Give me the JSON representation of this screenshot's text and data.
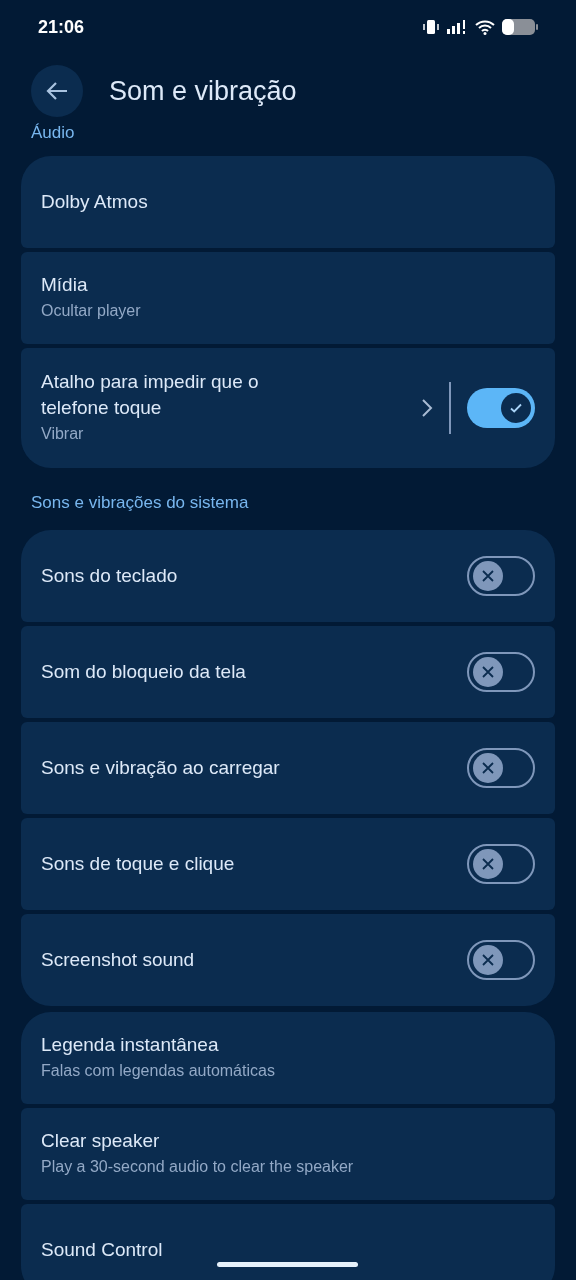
{
  "status_bar": {
    "time": "21:06"
  },
  "header": {
    "title": "Som e vibração"
  },
  "sections": [
    {
      "title": "Áudio",
      "items": [
        {
          "kind": "link",
          "label": "Dolby Atmos"
        },
        {
          "kind": "link",
          "label": "Mídia",
          "subtitle": "Ocultar player"
        },
        {
          "kind": "link_toggle",
          "label": "Atalho para impedir que o telefone toque",
          "subtitle": "Vibrar",
          "on": true
        }
      ]
    },
    {
      "title": "Sons e vibrações do sistema",
      "items": [
        {
          "kind": "toggle",
          "label": "Sons do teclado",
          "on": false
        },
        {
          "kind": "toggle",
          "label": "Som do bloqueio da tela",
          "on": false
        },
        {
          "kind": "toggle",
          "label": "Sons e vibração ao carregar",
          "on": false
        },
        {
          "kind": "toggle",
          "label": "Sons de toque e clique",
          "on": false
        },
        {
          "kind": "toggle",
          "label": "Screenshot sound",
          "on": false
        }
      ]
    },
    {
      "items": [
        {
          "kind": "link",
          "label": "Legenda instantânea",
          "subtitle": "Falas com legendas automáticas"
        },
        {
          "kind": "link",
          "label": "Clear speaker",
          "subtitle": "Play a 30-second audio to clear the speaker"
        },
        {
          "kind": "link",
          "label": "Sound Control"
        }
      ]
    }
  ]
}
